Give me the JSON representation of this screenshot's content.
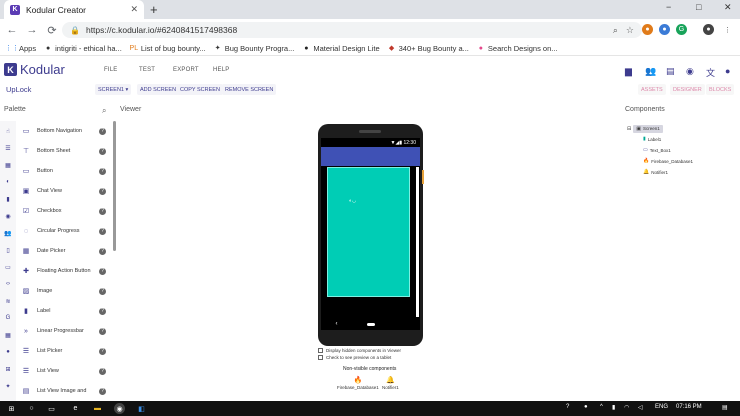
{
  "browser": {
    "tab_title": "Kodular Creator",
    "tab_favicon": "K",
    "new_tab": "+",
    "url": "https://c.kodular.io/#6240841517498368",
    "win_min": "−",
    "win_max": "□",
    "win_close": "✕",
    "back": "←",
    "forward": "→",
    "reload": "⟳",
    "bookmarks": [
      {
        "label": "Apps",
        "icon": "apps-grid-icon",
        "glyph": "⋮⋮"
      },
      {
        "label": "intigriti - ethical ha...",
        "icon": "intigriti-icon",
        "glyph": "●"
      },
      {
        "label": "List of bug bounty...",
        "icon": "pl-icon",
        "glyph": "PL"
      },
      {
        "label": "Bug Bounty Progra...",
        "icon": "bookmark-icon",
        "glyph": "✦"
      },
      {
        "label": "Material Design Lite",
        "icon": "github-icon",
        "glyph": "●"
      },
      {
        "label": "340+ Bug Bounty a...",
        "icon": "bug-icon",
        "glyph": "◆"
      },
      {
        "label": "Search Designs on...",
        "icon": "dribbble-icon",
        "glyph": "●"
      }
    ]
  },
  "app": {
    "logo_letter": "K",
    "name": "Kodular",
    "menu": [
      "FILE",
      "TEST",
      "EXPORT",
      "HELP"
    ],
    "project_name": "UpLock",
    "screen_select": "SCREEN1 ▾",
    "toolbar": [
      "ADD SCREEN",
      "COPY SCREEN",
      "REMOVE SCREEN"
    ],
    "right_toolbar": [
      "ASSETS",
      "DESIGNER",
      "BLOCKS"
    ],
    "colors": {
      "brand": "#3d3b8e",
      "app_bar": "#3f51b5",
      "content_bg": "#00cdb5"
    }
  },
  "palette": {
    "heading": "Palette",
    "items": [
      {
        "label": "Bottom Navigation",
        "glyph": "▭"
      },
      {
        "label": "Bottom Sheet",
        "glyph": "⊤"
      },
      {
        "label": "Button",
        "glyph": "▭"
      },
      {
        "label": "Chat View",
        "glyph": "▣"
      },
      {
        "label": "Checkbox",
        "glyph": "☑"
      },
      {
        "label": "Circular Progress",
        "glyph": "◌"
      },
      {
        "label": "Date Picker",
        "glyph": "▦"
      },
      {
        "label": "Floating Action Button",
        "glyph": "✚"
      },
      {
        "label": "Image",
        "glyph": "▨"
      },
      {
        "label": "Label",
        "glyph": "▮"
      },
      {
        "label": "Linear Progressbar",
        "glyph": "»"
      },
      {
        "label": "List Picker",
        "glyph": "☰"
      },
      {
        "label": "List View",
        "glyph": "☰"
      },
      {
        "label": "List View Image and",
        "glyph": "▤"
      }
    ],
    "help": "?"
  },
  "viewer": {
    "heading": "Viewer",
    "status_time": "12:30",
    "label_text": "◐◡",
    "checkbox_hidden": "Display hidden components in Viewer",
    "checkbox_tablet": "Check to see preview on a tablet",
    "nonvisible_heading": "Non-visible components",
    "nonvisible": [
      {
        "label": "Firebase_Database1",
        "glyph": "🔥"
      },
      {
        "label": "Notifier1",
        "glyph": "🔔"
      }
    ]
  },
  "components": {
    "heading": "Components",
    "tree": [
      {
        "label": "Screen1",
        "glyph": "▣"
      },
      {
        "label": "Label1",
        "glyph": "▮"
      },
      {
        "label": "Text_Box1",
        "glyph": "▭"
      },
      {
        "label": "Firebase_Database1",
        "glyph": "🔥"
      },
      {
        "label": "Notifier1",
        "glyph": "🔔"
      }
    ]
  },
  "taskbar": {
    "lang": "ENG",
    "time": "07:16 PM"
  }
}
